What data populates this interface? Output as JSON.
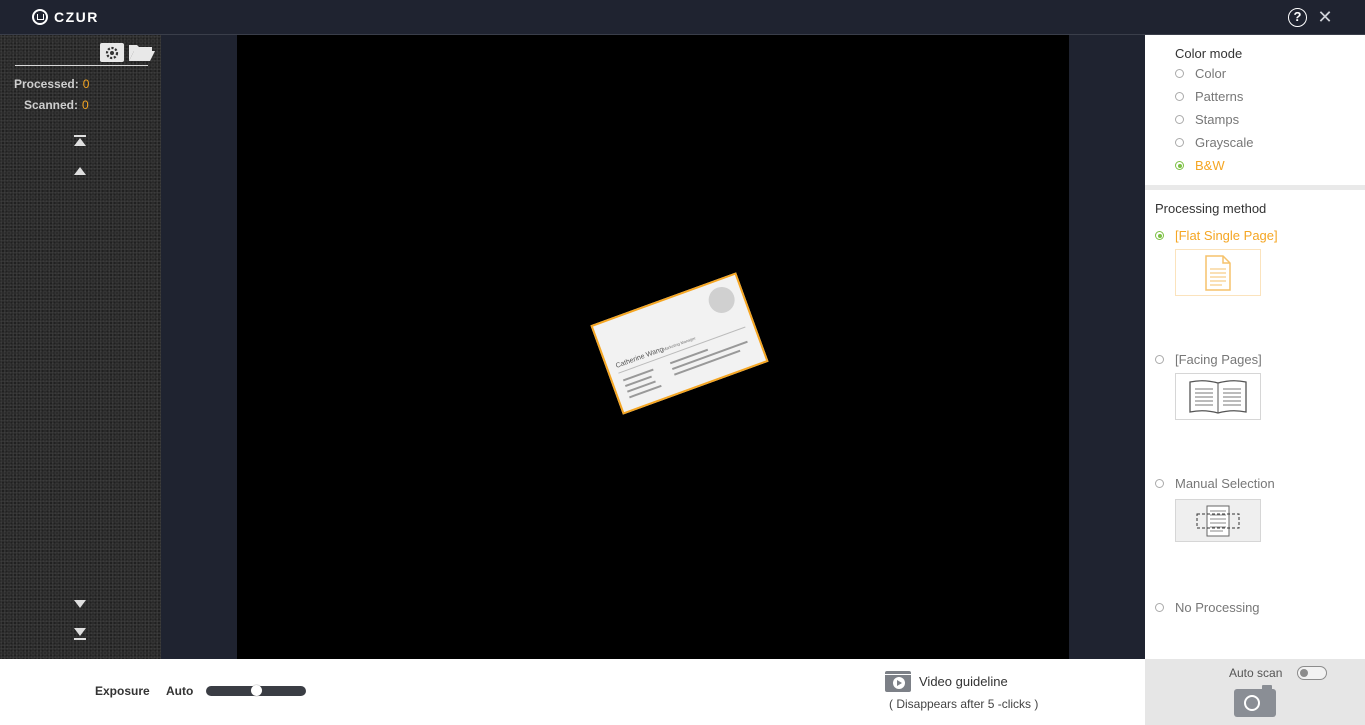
{
  "app": {
    "logo_text": "CZUR"
  },
  "titlebar": {
    "help_icon": "question-circle-icon",
    "help_glyph": "?",
    "close_icon": "close-icon",
    "close_glyph": "✕"
  },
  "left_panel": {
    "processed_label": "Processed:",
    "processed_count": "0",
    "scanned_label": "Scanned:",
    "scanned_count": "0",
    "icons": [
      "settings-icon",
      "folder-icon",
      "first-page-icon",
      "prev-page-icon",
      "next-page-icon",
      "last-page-icon"
    ]
  },
  "preview": {
    "card_name": "Catherine Wang",
    "card_title": "Marketing Manager"
  },
  "color_mode": {
    "title": "Color mode",
    "options": [
      {
        "label": "Color",
        "selected": false
      },
      {
        "label": "Patterns",
        "selected": false
      },
      {
        "label": "Stamps",
        "selected": false
      },
      {
        "label": "Grayscale",
        "selected": false
      },
      {
        "label": "B&W",
        "selected": true
      }
    ]
  },
  "processing_method": {
    "title": "Processing method",
    "options": [
      {
        "label": "[Flat Single Page]",
        "selected": true,
        "icon": "single-page-icon"
      },
      {
        "label": "[Facing Pages]",
        "selected": false,
        "icon": "open-book-icon"
      },
      {
        "label": "Manual Selection",
        "selected": false,
        "icon": "manual-selection-icon"
      },
      {
        "label": "No Processing",
        "selected": false
      }
    ]
  },
  "bottom": {
    "exposure_label": "Exposure",
    "auto_label": "Auto",
    "exposure_level": 0.5,
    "video_guideline": "Video guideline",
    "video_note": "( Disappears after 5 -clicks )",
    "auto_scan_label": "Auto scan",
    "auto_scan_on": false
  },
  "colors": {
    "accent": "#f5a623",
    "radio_selected": "#7cc043",
    "titlebar": "#1f2330"
  }
}
